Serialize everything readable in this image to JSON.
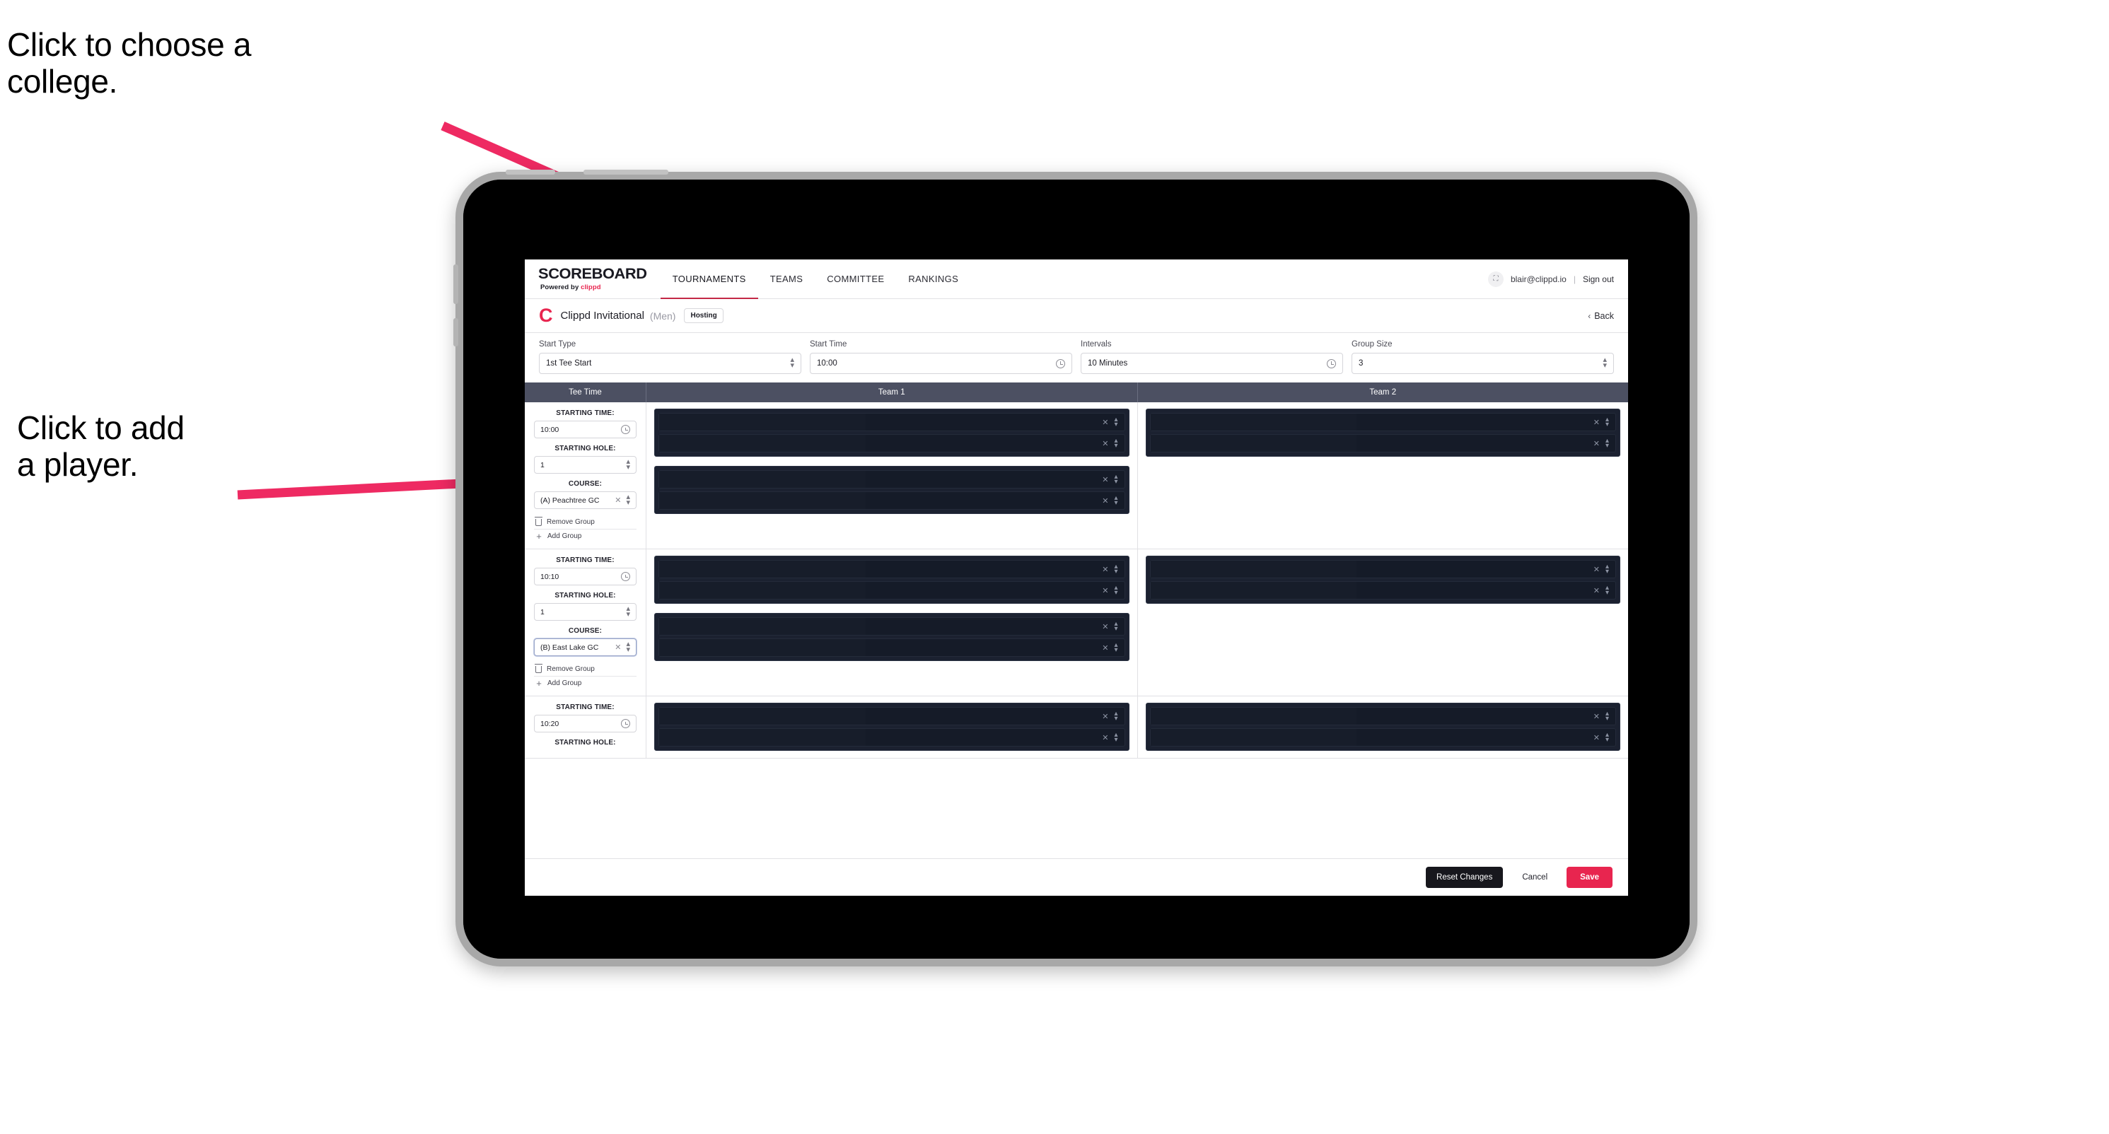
{
  "annotations": {
    "college": "Click to choose a\ncollege.",
    "player": "Click to add\na player."
  },
  "colors": {
    "accent": "#e8254f",
    "tab_underline": "#c32846",
    "table_header_bg": "#4c5062",
    "player_block_bg": "#1b2130",
    "reset_btn_bg": "#17171d"
  },
  "topnav": {
    "logo_main": "SCOREBOARD",
    "logo_sub_prefix": "Powered by ",
    "logo_sub_brand": "clippd",
    "tabs": [
      {
        "label": "TOURNAMENTS",
        "active": true
      },
      {
        "label": "TEAMS",
        "active": false
      },
      {
        "label": "COMMITTEE",
        "active": false
      },
      {
        "label": "RANKINGS",
        "active": false
      }
    ],
    "avatar_glyph": "⛶",
    "user_email": "blair@clippd.io",
    "separator": "|",
    "sign_out": "Sign out"
  },
  "tournament_header": {
    "logo_letter": "C",
    "title": "Clippd Invitational",
    "gender": "(Men)",
    "badge": "Hosting",
    "back_chevron": "‹",
    "back_label": "Back"
  },
  "controls": [
    {
      "label": "Start Type",
      "value": "1st Tee Start",
      "affordance": "stepper"
    },
    {
      "label": "Start Time",
      "value": "10:00",
      "affordance": "clock"
    },
    {
      "label": "Intervals",
      "value": "10 Minutes",
      "affordance": "clock"
    },
    {
      "label": "Group Size",
      "value": "3",
      "affordance": "stepper"
    }
  ],
  "table": {
    "columns": [
      "Tee Time",
      "Team 1",
      "Team 2"
    ],
    "field_labels": {
      "starting_time": "STARTING TIME:",
      "starting_hole": "STARTING HOLE:",
      "course": "COURSE:"
    },
    "group_actions": {
      "remove": "Remove Group",
      "add": "Add Group"
    },
    "rows": [
      {
        "starting_time": "10:00",
        "starting_hole": "1",
        "course": "(A) Peachtree GC",
        "course_focused": false,
        "team1_groups": [
          {
            "players": [
              "",
              ""
            ]
          },
          {
            "players": [
              "",
              ""
            ]
          }
        ],
        "team2_groups": [
          {
            "players": [
              "",
              ""
            ]
          }
        ]
      },
      {
        "starting_time": "10:10",
        "starting_hole": "1",
        "course": "(B) East Lake GC",
        "course_focused": true,
        "team1_groups": [
          {
            "players": [
              "",
              ""
            ]
          },
          {
            "players": [
              "",
              ""
            ]
          }
        ],
        "team2_groups": [
          {
            "players": [
              "",
              ""
            ]
          }
        ]
      },
      {
        "starting_time": "10:20",
        "starting_hole": "",
        "course": "",
        "course_focused": false,
        "partial": true,
        "team1_groups": [
          {
            "players": [
              "",
              ""
            ]
          }
        ],
        "team2_groups": [
          {
            "players": [
              "",
              ""
            ]
          }
        ]
      }
    ]
  },
  "footer": {
    "reset": "Reset Changes",
    "cancel": "Cancel",
    "save": "Save"
  }
}
